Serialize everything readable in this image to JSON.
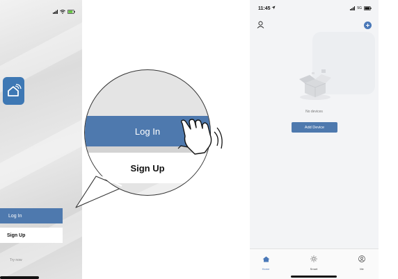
{
  "left_screen": {
    "login_label": "Log In",
    "signup_label": "Sign Up",
    "try_now_label": "Try now"
  },
  "magnifier": {
    "login_label": "Log In",
    "signup_label": "Sign Up"
  },
  "right_screen": {
    "status_time": "11:45",
    "status_network": "5G",
    "empty_text": "No devices",
    "add_device_label": "Add Device",
    "tabs": [
      {
        "label": "Home",
        "icon": "home-icon"
      },
      {
        "label": "Smart",
        "icon": "sun-icon"
      },
      {
        "label": "Me",
        "icon": "user-icon"
      }
    ]
  },
  "colors": {
    "primary_blue": "#4e79ae",
    "logo_blue": "#3e78b4",
    "active_tab": "#4b79b8"
  }
}
